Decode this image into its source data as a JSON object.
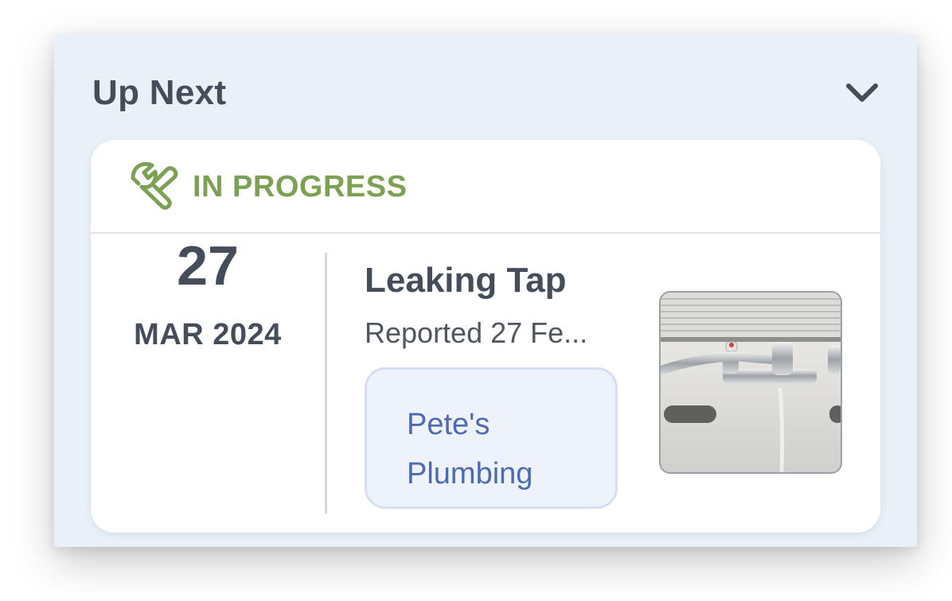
{
  "section": {
    "title": "Up Next",
    "toggle_icon": "chevron-down-icon"
  },
  "job": {
    "status": {
      "label": "IN PROGRESS",
      "icon": "wrench-icon",
      "color": "#7da152"
    },
    "date": {
      "day": "27",
      "month_year": "MAR 2024"
    },
    "title": "Leaking Tap",
    "reported": "Reported 27 Fe...",
    "provider": {
      "line1": "Pete's",
      "line2": "Plumbing",
      "color": "#4d6bb1"
    },
    "photo_icon": "leaking-tap-photo"
  }
}
